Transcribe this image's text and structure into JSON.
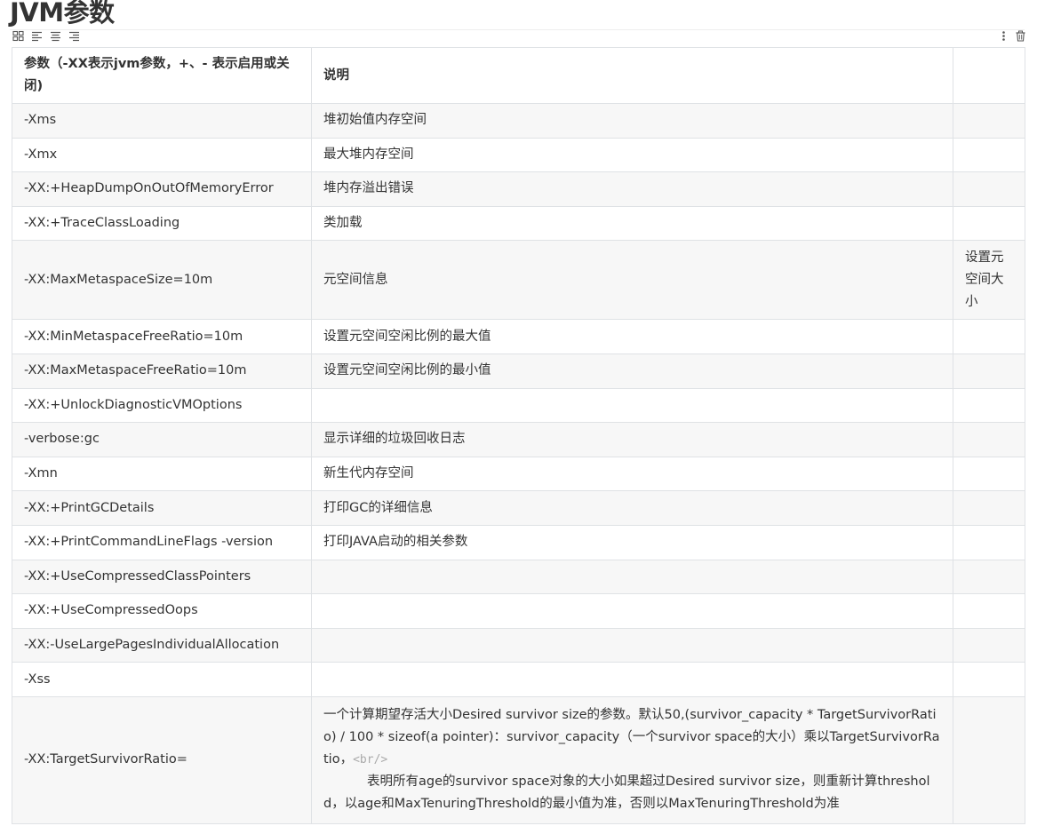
{
  "page": {
    "title": "JVM参数"
  },
  "toolbar": {
    "left_icons": [
      "table-grid-icon",
      "align-left-icon",
      "align-center-icon",
      "align-right-icon"
    ],
    "right_icons": [
      "more-vertical-icon",
      "delete-icon"
    ]
  },
  "table": {
    "headers": [
      "参数（-XX表示jvm参数，+、- 表示启用或关闭)",
      "说明",
      ""
    ],
    "rows": [
      [
        "-Xms",
        "堆初始值内存空间",
        ""
      ],
      [
        "-Xmx",
        "最大堆内存空间",
        ""
      ],
      [
        "-XX:+HeapDumpOnOutOfMemoryError",
        "堆内存溢出错误",
        ""
      ],
      [
        "-XX:+TraceClassLoading",
        "类加载",
        ""
      ],
      [
        "-XX:MaxMetaspaceSize=10m",
        "元空间信息",
        "设置元空间大小"
      ],
      [
        "-XX:MinMetaspaceFreeRatio=10m",
        "设置元空间空闲比例的最大值",
        ""
      ],
      [
        "-XX:MaxMetaspaceFreeRatio=10m",
        "设置元空间空闲比例的最小值",
        ""
      ],
      [
        "-XX:+UnlockDiagnosticVMOptions",
        "",
        ""
      ],
      [
        "-verbose:gc",
        "显示详细的垃圾回收日志",
        ""
      ],
      [
        "-Xmn",
        "新生代内存空间",
        ""
      ],
      [
        "-XX:+PrintGCDetails",
        "打印GC的详细信息",
        ""
      ],
      [
        "-XX:+PrintCommandLineFlags -version",
        "打印JAVA启动的相关参数",
        ""
      ],
      [
        "-XX:+UseCompressedClassPointers",
        "",
        ""
      ],
      [
        "-XX:+UseCompressedOops",
        "",
        ""
      ],
      [
        "-XX:-UseLargePagesIndividualAllocation",
        "",
        ""
      ],
      [
        "-Xss",
        "",
        ""
      ]
    ],
    "last_row": {
      "param": "-XX:TargetSurvivorRatio=",
      "desc_part1": "一个计算期望存活大小Desired survivor size的参数。默认50,(survivor_capacity * TargetSurvivorRatio) / 100 * sizeof(a pointer)：survivor_capacity（一个survivor space的大小）乘以TargetSurvivorRatio，",
      "desc_tag": "<br/>",
      "desc_part2": "表明所有age的survivor space对象的大小如果超过Desired survivor size，则重新计算threshold，以age和MaxTenuringThreshold的最小值为准，否则以MaxTenuringThreshold为准",
      "note": ""
    }
  }
}
